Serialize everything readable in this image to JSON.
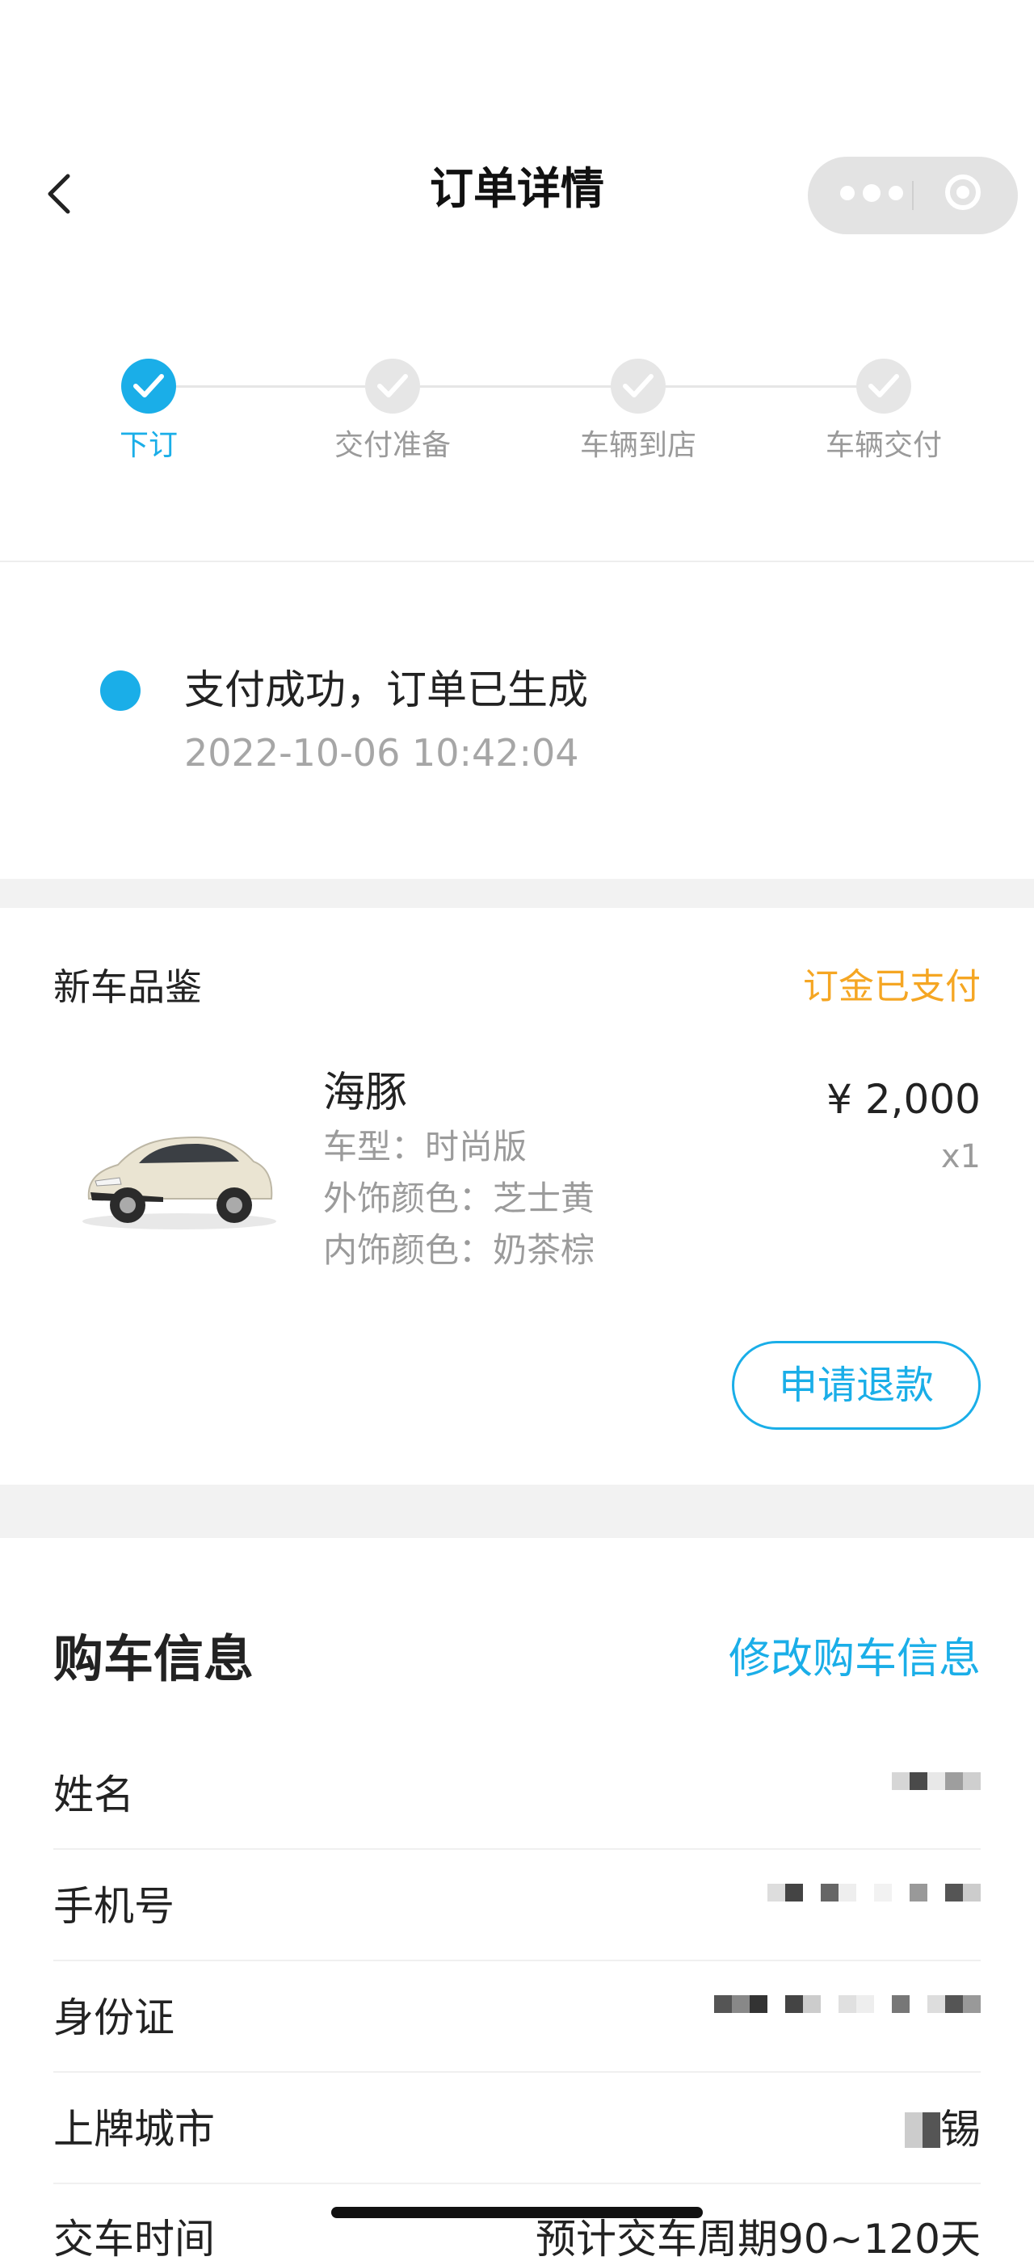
{
  "header": {
    "title": "订单详情",
    "back_icon": "chevron-left-icon",
    "menu_icon": "more-icon",
    "close_icon": "target-icon"
  },
  "steps": [
    {
      "label": "下订",
      "state": "active"
    },
    {
      "label": "交付准备",
      "state": "inactive"
    },
    {
      "label": "车辆到店",
      "state": "inactive"
    },
    {
      "label": "车辆交付",
      "state": "inactive"
    }
  ],
  "status": {
    "text": "支付成功，订单已生成",
    "time": "2022-10-06 10:42:04"
  },
  "product": {
    "section_title": "新车品鉴",
    "payment_status": "订金已支付",
    "name": "海豚",
    "specs": [
      "车型：时尚版",
      "外饰颜色：芝士黄",
      "内饰颜色：奶茶棕"
    ],
    "price": "¥ 2,000",
    "qty": "x1",
    "refund_label": "申请退款"
  },
  "purchase_info": {
    "title": "购车信息",
    "edit_label": "修改购车信息",
    "rows": [
      {
        "key": "姓名"
      },
      {
        "key": "手机号"
      },
      {
        "key": "身份证"
      },
      {
        "key": "上牌城市",
        "value_suffix": "锡"
      },
      {
        "key": "交车时间",
        "value": "预计交车周期90~120天"
      }
    ]
  },
  "colors": {
    "accent": "#1aaee8",
    "warning": "#f5a623",
    "muted": "#9b9b9b"
  }
}
